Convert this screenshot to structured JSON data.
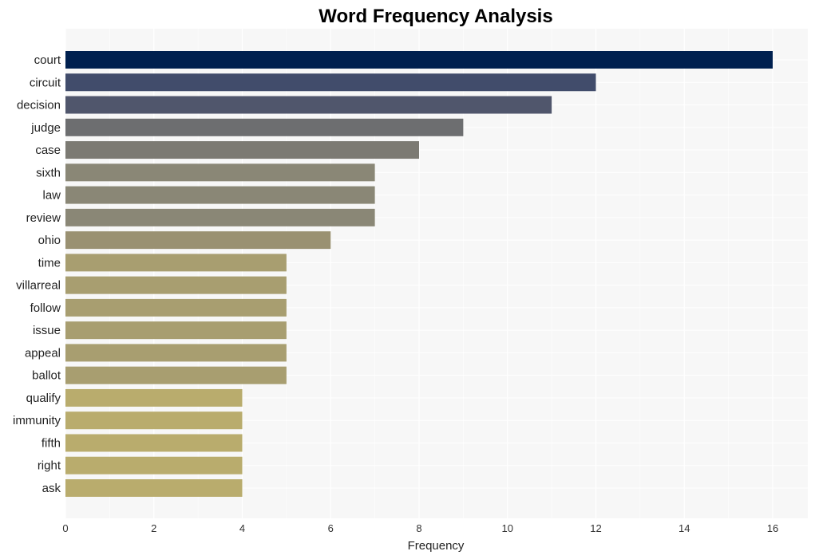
{
  "chart_data": {
    "type": "bar",
    "orientation": "horizontal",
    "title": "Word Frequency Analysis",
    "xlabel": "Frequency",
    "ylabel": "",
    "xlim": [
      0,
      16.8
    ],
    "xticks": [
      0,
      2,
      4,
      6,
      8,
      10,
      12,
      14,
      16
    ],
    "grid": true,
    "legend": "none",
    "categories": [
      "court",
      "circuit",
      "decision",
      "judge",
      "case",
      "sixth",
      "law",
      "review",
      "ohio",
      "time",
      "villarreal",
      "follow",
      "issue",
      "appeal",
      "ballot",
      "qualify",
      "immunity",
      "fifth",
      "right",
      "ask"
    ],
    "values": [
      16,
      12,
      11,
      9,
      8,
      7,
      7,
      7,
      6,
      5,
      5,
      5,
      5,
      5,
      5,
      4,
      4,
      4,
      4,
      4
    ],
    "colors": [
      "#00204f",
      "#414c6b",
      "#50566c",
      "#6d6e70",
      "#7c7a73",
      "#8a8776",
      "#8a8776",
      "#8a8776",
      "#9a9172",
      "#a89e70",
      "#a89e70",
      "#a89e70",
      "#a89e70",
      "#a89e70",
      "#a89e70",
      "#b9ac6d",
      "#b9ac6d",
      "#b9ac6d",
      "#b9ac6d",
      "#b9ac6d"
    ],
    "background": "#f7f7f7",
    "gridcolor": "#ffffff"
  }
}
